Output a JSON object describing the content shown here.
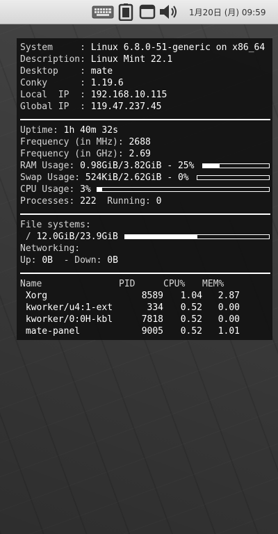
{
  "topbar": {
    "icons": [
      "keyboard-icon",
      "battery-icon",
      "window-icon",
      "volume-icon"
    ],
    "clock": "1月20日 (月) 09:59"
  },
  "system": {
    "rows": [
      {
        "key": "System     : ",
        "value": "Linux 6.8.0-51-generic on x86_64"
      },
      {
        "key": "Description: ",
        "value": "Linux Mint 22.1"
      },
      {
        "key": "Desktop    : ",
        "value": "mate"
      },
      {
        "key": "Conky      : ",
        "value": "1.19.6"
      },
      {
        "key": "Local  IP  : ",
        "value": "192.168.10.115"
      },
      {
        "key": "Global IP  : ",
        "value": "119.47.237.45"
      }
    ]
  },
  "stats": {
    "uptime_label": "Uptime: ",
    "uptime": "1h 40m 32s",
    "freq_mhz_label": "Frequency (in MHz): ",
    "freq_mhz": "2688",
    "freq_ghz_label": "Frequency (in GHz): ",
    "freq_ghz": "2.69",
    "ram_label": "RAM Usage: ",
    "ram": "0.98GiB/3.82GiB - 25%",
    "ram_percent": 25,
    "swap_label": "Swap Usage: ",
    "swap": "524KiB/2.62GiB - 0%",
    "swap_percent": 0,
    "cpu_label": "CPU Usage: ",
    "cpu": "3%",
    "cpu_percent": 3,
    "proc_label": "Processes: ",
    "proc": "222",
    "running_label": "  Running: ",
    "running": "0"
  },
  "fs": {
    "title": "File systems:",
    "root_label": " / ",
    "root": "12.0GiB/23.9GiB",
    "root_percent": 50,
    "net_title": "Networking:",
    "up_label": "Up: ",
    "up": "0B",
    "down_label": "  - Down: ",
    "down": "0B"
  },
  "processes": {
    "headers": [
      "Name",
      "PID",
      "CPU%",
      "MEM%"
    ],
    "rows": [
      {
        "name": " Xorg",
        "pid": "8589",
        "cpu": "1.04",
        "mem": "2.87"
      },
      {
        "name": " kworker/u4:1-ext",
        "pid": "334",
        "cpu": "0.52",
        "mem": "0.00"
      },
      {
        "name": " kworker/0:0H-kbl",
        "pid": "7818",
        "cpu": "0.52",
        "mem": "0.00"
      },
      {
        "name": " mate-panel",
        "pid": "9005",
        "cpu": "0.52",
        "mem": "1.01"
      }
    ]
  }
}
